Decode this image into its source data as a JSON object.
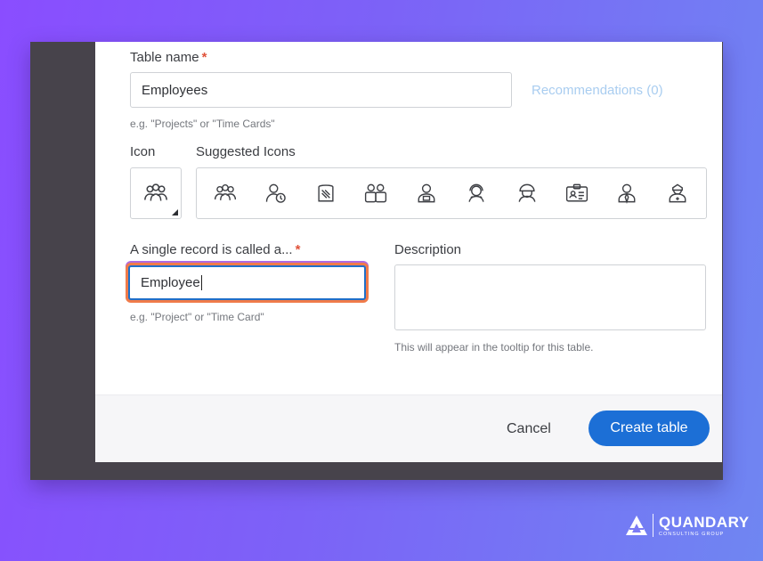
{
  "dialog": {
    "table_name_label": "Table name",
    "required_mark": "*",
    "table_name_value": "Employees",
    "recommendations_link": "Recommendations (0)",
    "table_name_hint": "e.g. \"Projects\" or \"Time Cards\"",
    "icon_label": "Icon",
    "suggested_icons_label": "Suggested Icons",
    "selected_icon": "people-group-icon",
    "suggested_icons": [
      "people-group-icon",
      "user-clock-icon",
      "document-icon",
      "users-card-icon",
      "user-lock-icon",
      "user-headset-icon",
      "user-hardhat-icon",
      "id-card-icon",
      "user-tie-icon",
      "user-nurse-icon"
    ],
    "single_record_label": "A single record is called a...",
    "single_record_value": "Employee",
    "single_record_hint": "e.g. \"Project\" or \"Time Card\"",
    "description_label": "Description",
    "description_value": "",
    "description_hint": "This will appear in the tooltip for this table.",
    "cancel_label": "Cancel",
    "create_label": "Create table"
  },
  "brand": {
    "name": "QUANDARY",
    "tagline": "CONSULTING GROUP"
  },
  "colors": {
    "primary_button": "#1c6fd6",
    "required": "#e0523a",
    "focus_ring": "#f07b4a",
    "link_disabled": "#a9cdf0"
  }
}
